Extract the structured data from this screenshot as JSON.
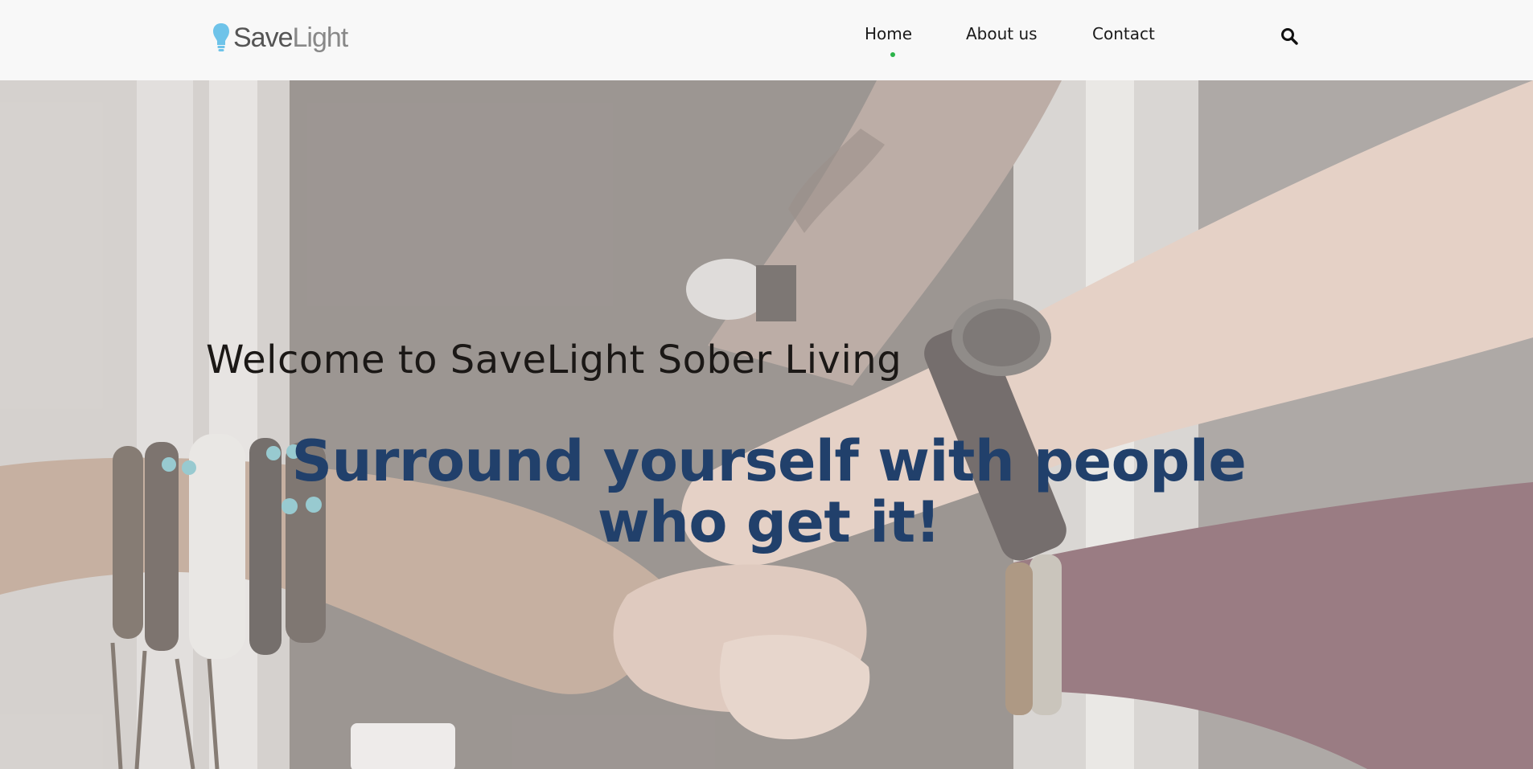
{
  "brand": {
    "name_part1": "Save",
    "name_part2": "Light",
    "bulb_color": "#6ec3e9"
  },
  "nav": {
    "items": [
      {
        "label": "Home",
        "active": true
      },
      {
        "label": "About us",
        "active": false
      },
      {
        "label": "Contact",
        "active": false
      }
    ],
    "active_indicator_color": "#2bb34a",
    "search_icon": "search-icon"
  },
  "hero": {
    "welcome": "Welcome to SaveLight Sober Living",
    "tagline_line1": "Surround yourself with people",
    "tagline_line2": "who get it!",
    "tagline_color": "#21406b"
  }
}
